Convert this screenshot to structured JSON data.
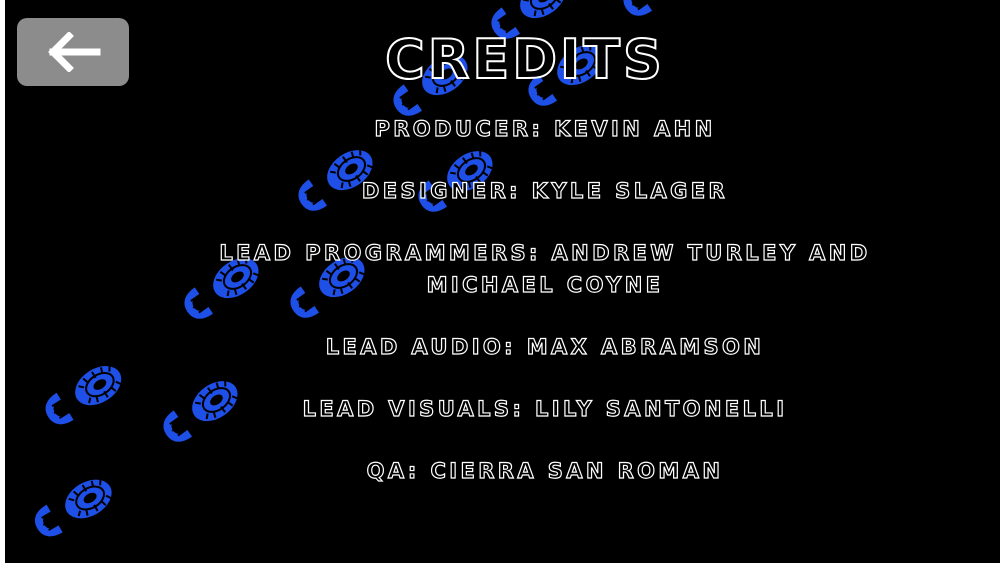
{
  "screen": {
    "title": "Credits",
    "background_color": "#000000",
    "footprint_color": "#1e4fe6",
    "back_button": {
      "icon": "left-arrow-icon",
      "color": "#8c8c8c"
    }
  },
  "credits": [
    "Producer: Kevin Ahn",
    "Designer: Kyle Slager",
    "Lead Programmers: Andrew Turley and",
    "Michael Coyne",
    "Lead Audio: Max Abramson",
    "Lead Visuals: Lily Santonelli",
    "QA: Cierra San Roman"
  ]
}
